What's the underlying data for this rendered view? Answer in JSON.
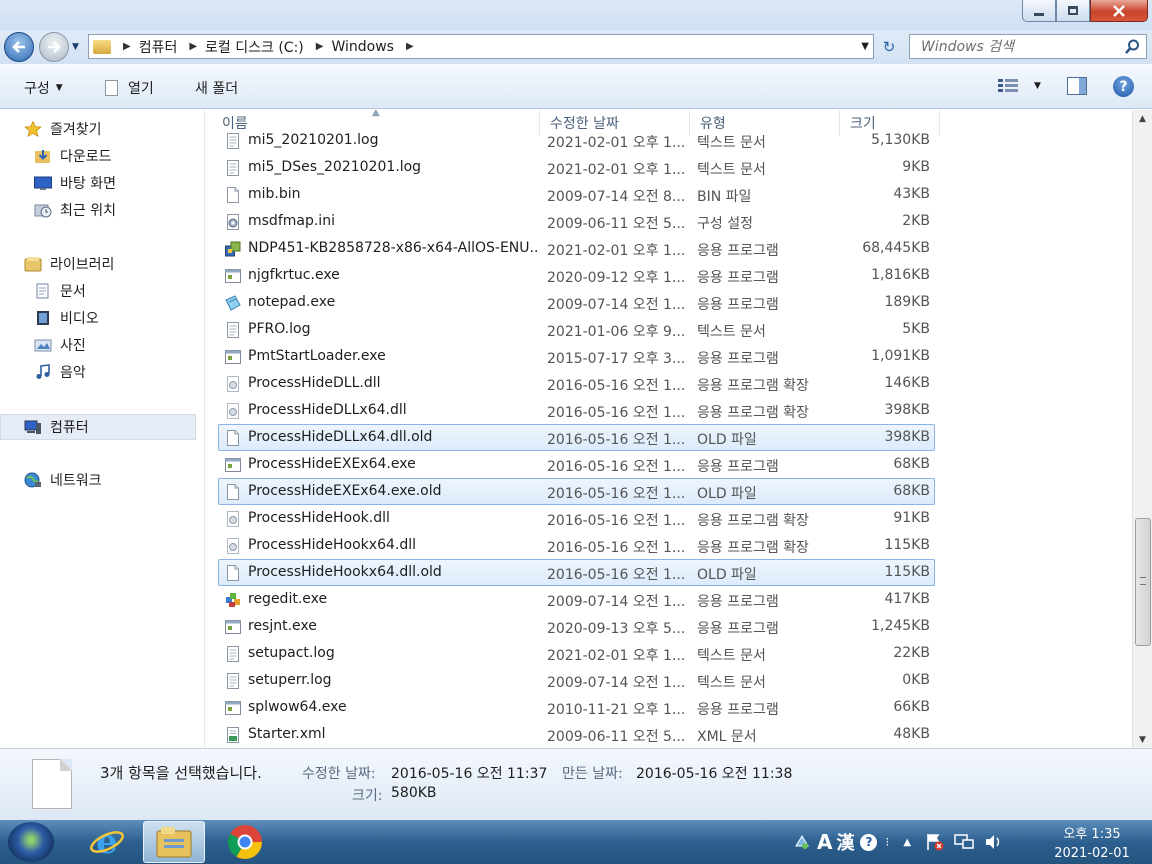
{
  "address": {
    "crumbs": [
      "컴퓨터",
      "로컬 디스크 (C:)",
      "Windows"
    ]
  },
  "search": {
    "placeholder": "Windows 검색"
  },
  "toolbar": {
    "organize": "구성",
    "open": "열기",
    "new_folder": "새 폴더"
  },
  "nav": {
    "favorites": "즐겨찾기",
    "downloads": "다운로드",
    "desktop": "바탕 화면",
    "recent": "최근 위치",
    "libraries": "라이브러리",
    "documents": "문서",
    "videos": "비디오",
    "pictures": "사진",
    "music": "음악",
    "computer": "컴퓨터",
    "network": "네트워크"
  },
  "columns": {
    "name": "이름",
    "date": "수정한 날짜",
    "type": "유형",
    "size": "크기"
  },
  "files": [
    {
      "name": "mi5_20210201.log",
      "date": "2021-02-01 오후 1...",
      "type": "텍스트 문서",
      "size": "5,130KB",
      "icon": "text-file-icon",
      "selected": false
    },
    {
      "name": "mi5_DSes_20210201.log",
      "date": "2021-02-01 오후 1...",
      "type": "텍스트 문서",
      "size": "9KB",
      "icon": "text-file-icon",
      "selected": false
    },
    {
      "name": "mib.bin",
      "date": "2009-07-14 오전 8...",
      "type": "BIN 파일",
      "size": "43KB",
      "icon": "blank-file-icon",
      "selected": false
    },
    {
      "name": "msdfmap.ini",
      "date": "2009-06-11 오전 5...",
      "type": "구성 설정",
      "size": "2KB",
      "icon": "config-file-icon",
      "selected": false
    },
    {
      "name": "NDP451-KB2858728-x86-x64-AllOS-ENU...",
      "date": "2021-02-01 오후 1...",
      "type": "응용 프로그램",
      "size": "68,445KB",
      "icon": "installer-icon",
      "selected": false
    },
    {
      "name": "njgfkrtuc.exe",
      "date": "2020-09-12 오후 1...",
      "type": "응용 프로그램",
      "size": "1,816KB",
      "icon": "exe-icon",
      "selected": false
    },
    {
      "name": "notepad.exe",
      "date": "2009-07-14 오전 1...",
      "type": "응용 프로그램",
      "size": "189KB",
      "icon": "notepad-icon",
      "selected": false
    },
    {
      "name": "PFRO.log",
      "date": "2021-01-06 오후 9...",
      "type": "텍스트 문서",
      "size": "5KB",
      "icon": "text-file-icon",
      "selected": false
    },
    {
      "name": "PmtStartLoader.exe",
      "date": "2015-07-17 오후 3...",
      "type": "응용 프로그램",
      "size": "1,091KB",
      "icon": "exe-icon",
      "selected": false
    },
    {
      "name": "ProcessHideDLL.dll",
      "date": "2016-05-16 오전 1...",
      "type": "응용 프로그램 확장",
      "size": "146KB",
      "icon": "dll-icon",
      "selected": false
    },
    {
      "name": "ProcessHideDLLx64.dll",
      "date": "2016-05-16 오전 1...",
      "type": "응용 프로그램 확장",
      "size": "398KB",
      "icon": "dll-icon",
      "selected": false
    },
    {
      "name": "ProcessHideDLLx64.dll.old",
      "date": "2016-05-16 오전 1...",
      "type": "OLD 파일",
      "size": "398KB",
      "icon": "blank-file-icon",
      "selected": true
    },
    {
      "name": "ProcessHideEXEx64.exe",
      "date": "2016-05-16 오전 1...",
      "type": "응용 프로그램",
      "size": "68KB",
      "icon": "exe-icon",
      "selected": false
    },
    {
      "name": "ProcessHideEXEx64.exe.old",
      "date": "2016-05-16 오전 1...",
      "type": "OLD 파일",
      "size": "68KB",
      "icon": "blank-file-icon",
      "selected": true
    },
    {
      "name": "ProcessHideHook.dll",
      "date": "2016-05-16 오전 1...",
      "type": "응용 프로그램 확장",
      "size": "91KB",
      "icon": "dll-icon",
      "selected": false
    },
    {
      "name": "ProcessHideHookx64.dll",
      "date": "2016-05-16 오전 1...",
      "type": "응용 프로그램 확장",
      "size": "115KB",
      "icon": "dll-icon",
      "selected": false
    },
    {
      "name": "ProcessHideHookx64.dll.old",
      "date": "2016-05-16 오전 1...",
      "type": "OLD 파일",
      "size": "115KB",
      "icon": "blank-file-icon",
      "selected": true
    },
    {
      "name": "regedit.exe",
      "date": "2009-07-14 오전 1...",
      "type": "응용 프로그램",
      "size": "417KB",
      "icon": "regedit-icon",
      "selected": false
    },
    {
      "name": "resjnt.exe",
      "date": "2020-09-13 오후 5...",
      "type": "응용 프로그램",
      "size": "1,245KB",
      "icon": "exe-icon",
      "selected": false
    },
    {
      "name": "setupact.log",
      "date": "2021-02-01 오후 1...",
      "type": "텍스트 문서",
      "size": "22KB",
      "icon": "text-file-icon",
      "selected": false
    },
    {
      "name": "setuperr.log",
      "date": "2009-07-14 오전 1...",
      "type": "텍스트 문서",
      "size": "0KB",
      "icon": "text-file-icon",
      "selected": false
    },
    {
      "name": "splwow64.exe",
      "date": "2010-11-21 오후 1...",
      "type": "응용 프로그램",
      "size": "66KB",
      "icon": "exe-icon",
      "selected": false
    },
    {
      "name": "Starter.xml",
      "date": "2009-06-11 오전 5...",
      "type": "XML 문서",
      "size": "48KB",
      "icon": "xml-file-icon",
      "selected": false
    }
  ],
  "details": {
    "summary": "3개 항목을 선택했습니다.",
    "modified_label": "수정한 날짜:",
    "modified_value": "2016-05-16 오전 11:37",
    "created_label": "만든 날짜:",
    "created_value": "2016-05-16 오전 11:38",
    "size_label": "크기:",
    "size_value": "580KB"
  },
  "tray": {
    "ime_a": "A",
    "ime_hanja": "漢"
  },
  "clock": {
    "time": "오후 1:35",
    "date": "2021-02-01"
  },
  "colors": {
    "selection_border": "#8bb3e3",
    "selection_fill": "#dcebfc",
    "taskbar": "#2d5f8f",
    "close_button": "#c8452c"
  }
}
